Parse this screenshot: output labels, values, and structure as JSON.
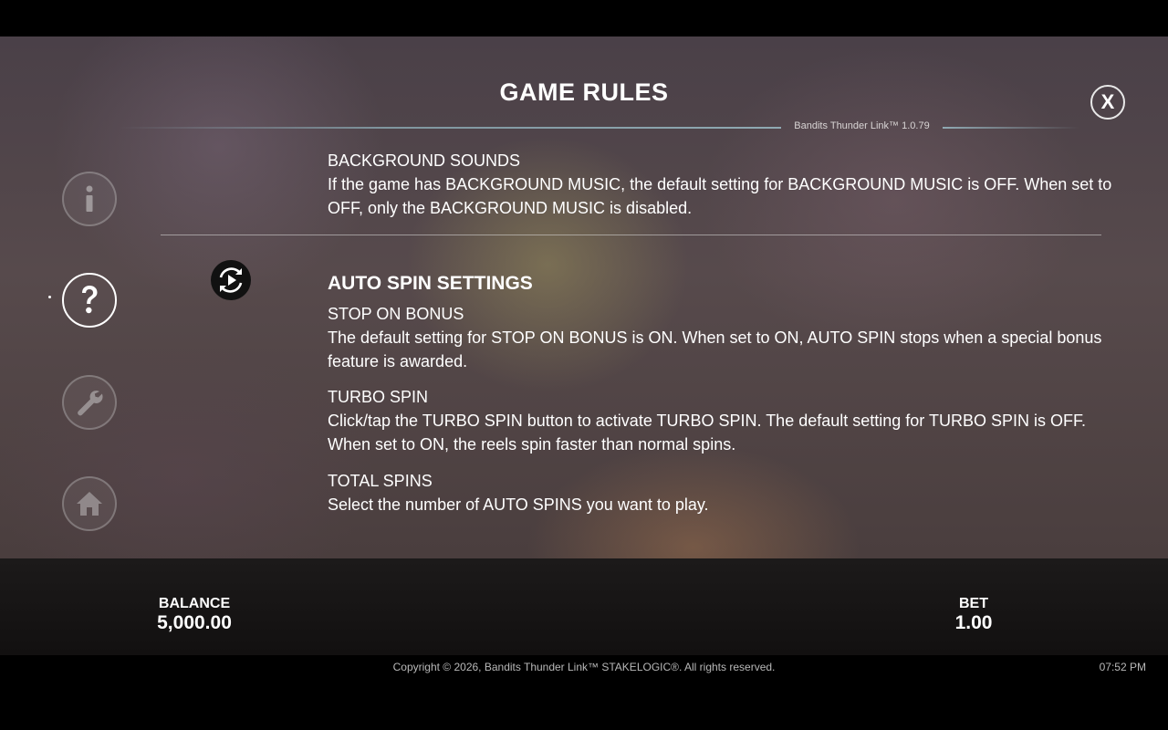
{
  "header": {
    "title": "GAME RULES",
    "version": "Bandits Thunder Link™ 1.0.79",
    "close_label": "X"
  },
  "nav": {
    "items": [
      {
        "name": "info",
        "icon": "info-icon",
        "active": false
      },
      {
        "name": "rules",
        "icon": "question-icon",
        "active": true
      },
      {
        "name": "settings",
        "icon": "wrench-icon",
        "active": false
      },
      {
        "name": "home",
        "icon": "home-icon",
        "active": false
      }
    ]
  },
  "content": {
    "background_sounds": {
      "heading": "BACKGROUND SOUNDS",
      "text": "If the game has BACKGROUND MUSIC, the default setting for BACKGROUND MUSIC is OFF. When set to OFF, only the BACKGROUND MUSIC is disabled."
    },
    "auto_spin": {
      "title": "AUTO SPIN SETTINGS",
      "icon": "autospin-icon",
      "items": [
        {
          "heading": "STOP ON BONUS",
          "text": "The default setting for STOP ON BONUS is ON. When set to ON, AUTO SPIN stops when a special bonus feature is awarded."
        },
        {
          "heading": "TURBO SPIN",
          "text": "Click/tap the TURBO SPIN button to activate TURBO SPIN. The default setting for TURBO SPIN is OFF. When set to ON, the reels spin faster than normal spins."
        },
        {
          "heading": "TOTAL SPINS",
          "text": "Select the number of AUTO SPINS you want to play."
        }
      ]
    }
  },
  "footer": {
    "balance_label": "BALANCE",
    "balance_value": "5,000.00",
    "bet_label": "BET",
    "bet_value": "1.00",
    "copyright": "Copyright © 2026, Bandits Thunder Link™ STAKELOGIC®. All rights reserved.",
    "time": "07:52 PM"
  },
  "colors": {
    "accent_line": "#8cb0ba",
    "text": "#ffffff",
    "footer_bg": "#161414"
  }
}
